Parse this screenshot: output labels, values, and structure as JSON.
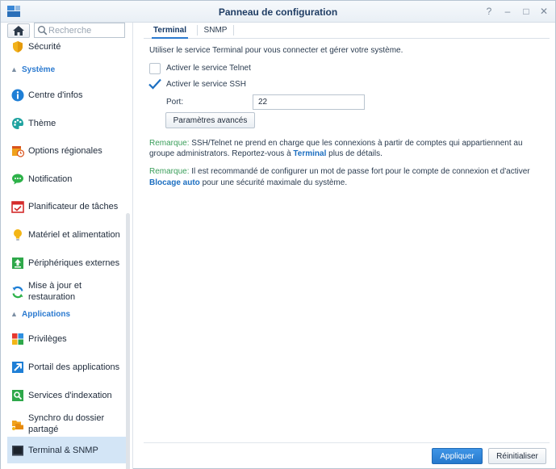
{
  "window": {
    "title": "Panneau de configuration",
    "controls": [
      "?",
      "–",
      "□",
      "✕"
    ]
  },
  "sidebar": {
    "search_placeholder": "Recherche",
    "items_top": [
      {
        "label": "Sécurité",
        "icon": "shield-icon"
      }
    ],
    "section_systeme": "Système",
    "items_systeme": [
      {
        "label": "Centre d'infos",
        "icon": "info-icon"
      },
      {
        "label": "Thème",
        "icon": "palette-icon"
      },
      {
        "label": "Options régionales",
        "icon": "calendar-clock-icon"
      },
      {
        "label": "Notification",
        "icon": "chat-bubble-icon"
      },
      {
        "label": "Planificateur de tâches",
        "icon": "task-calendar-icon"
      },
      {
        "label": "Matériel et alimentation",
        "icon": "lightbulb-icon"
      },
      {
        "label": "Périphériques externes",
        "icon": "upload-arrow-icon"
      },
      {
        "label_line1": "Mise à jour et",
        "label_line2": "restauration",
        "icon": "refresh-icon"
      }
    ],
    "section_applications": "Applications",
    "items_applications": [
      {
        "label": "Privilèges",
        "icon": "grid-icon"
      },
      {
        "label": "Portail des applications",
        "icon": "portal-arrow-icon"
      },
      {
        "label": "Services d'indexation",
        "icon": "search-index-icon"
      },
      {
        "label_line1": "Synchro du dossier",
        "label_line2": "partagé",
        "icon": "folder-sync-icon"
      },
      {
        "label": "Terminal & SNMP",
        "icon": "terminal-icon"
      }
    ]
  },
  "main": {
    "tabs": [
      {
        "label": "Terminal"
      },
      {
        "label": "SNMP"
      }
    ],
    "intro": "Utiliser le service Terminal pour vous connecter et gérer votre système.",
    "telnet_label": "Activer le service Telnet",
    "telnet_checked": false,
    "ssh_label": "Activer le service SSH",
    "ssh_checked": true,
    "port_label": "Port:",
    "port_value": "22",
    "advanced_button": "Paramètres avancés",
    "remark1": {
      "prefix": "Remarque:",
      "text1": " SSH/Telnet ne prend en charge que les connexions à partir de comptes qui appartiennent au",
      "text2": "groupe administrators. Reportez-vous à ",
      "link": "Terminal",
      "text3": " plus de détails."
    },
    "remark2": {
      "prefix": "Remarque:",
      "text1": " Il est recommandé de configurer un mot de passe fort pour le compte de connexion et d'activer",
      "link": "Blocage auto",
      "text2": " pour une sécurité maximale du système."
    },
    "apply_button": "Appliquer",
    "reset_button": "Réinitialiser"
  },
  "colors": {
    "accent": "#2b7ad0",
    "remark": "#3a9e5a",
    "active_item_bg": "#d3e5f6"
  }
}
